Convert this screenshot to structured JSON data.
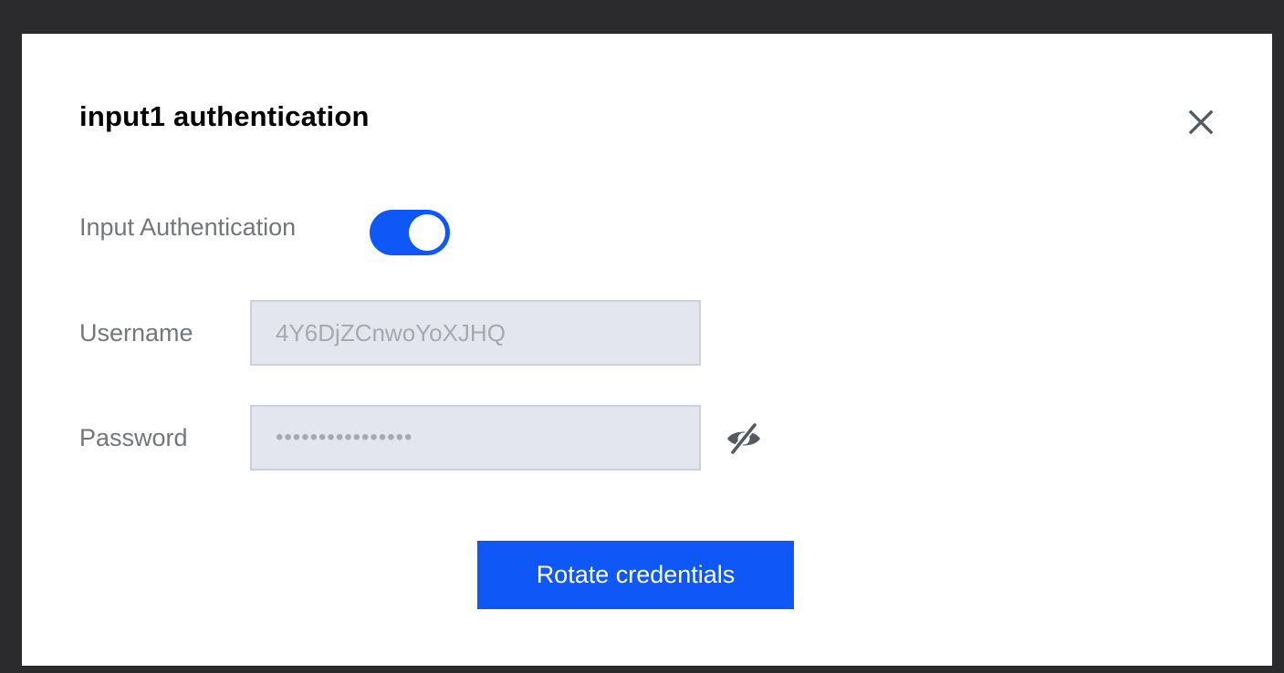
{
  "dialog": {
    "title": "input1 authentication",
    "close_icon": "close-icon"
  },
  "auth_toggle": {
    "label": "Input Authentication",
    "enabled": true,
    "on_color": "#0f58f7"
  },
  "username": {
    "label": "Username",
    "value": "4Y6DjZCnwoYoXJHQ"
  },
  "password": {
    "label": "Password",
    "masked_value": "••••••••••••••••",
    "visibility_icon": "eye-slash-icon"
  },
  "actions": {
    "rotate_label": "Rotate credentials",
    "accent_color": "#0f58f7"
  }
}
